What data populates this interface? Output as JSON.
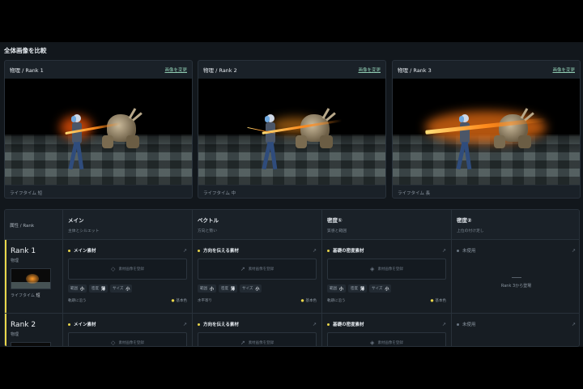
{
  "section_title": "全体画像を比較",
  "cards": [
    {
      "title": "物理 / Rank 1",
      "change": "画像を変更",
      "lifetime": "ライフタイム 短"
    },
    {
      "title": "物理 / Rank 2",
      "change": "画像を変更",
      "lifetime": "ライフタイム 中"
    },
    {
      "title": "物理 / Rank 3",
      "change": "画像を変更",
      "lifetime": "ライフタイム 長"
    }
  ],
  "table": {
    "attr_header": "属性 / Rank",
    "columns": [
      {
        "title": "メイン",
        "sub": "主体とシルエット"
      },
      {
        "title": "ベクトル",
        "sub": "方向と勢い"
      },
      {
        "title": "密度①",
        "sub": "質感と範囲"
      },
      {
        "title": "密度②",
        "sub": "上位の付け足し"
      }
    ],
    "rows": [
      {
        "rank": "Rank 1",
        "category": "物理",
        "lifetime_label": "ライフタイム",
        "lifetime_value": "短",
        "cells": [
          {
            "label": "メイン素材",
            "drop": "素材画像を登録",
            "params": [
              {
                "k": "範囲",
                "v": "小"
              },
              {
                "k": "密度",
                "v": "薄"
              },
              {
                "k": "サイズ",
                "v": "小"
              }
            ],
            "note": "軌跡に沿う",
            "status": "基本色"
          },
          {
            "label": "方向を伝える素材",
            "drop": "素材画像を登録",
            "params": [
              {
                "k": "範囲",
                "v": "小"
              },
              {
                "k": "密度",
                "v": "薄"
              },
              {
                "k": "サイズ",
                "v": "小"
              }
            ],
            "note": "水平寄り",
            "status": "基本色"
          },
          {
            "label": "基礎の密度素材",
            "drop": "素材画像を登録",
            "params": [
              {
                "k": "範囲",
                "v": "小"
              },
              {
                "k": "密度",
                "v": "薄"
              },
              {
                "k": "サイズ",
                "v": "小"
              }
            ],
            "note": "軌跡に沿う",
            "status": "基本色"
          },
          {
            "label": "未使用",
            "unused_text": "Rank 3から登場"
          }
        ]
      },
      {
        "rank": "Rank 2",
        "category": "物理",
        "cells": [
          {
            "label": "メイン素材",
            "drop": "素材画像を登録"
          },
          {
            "label": "方向を伝える素材",
            "drop": "素材画像を登録"
          },
          {
            "label": "基礎の密度素材",
            "drop": "素材画像を登録"
          },
          {
            "label": "未使用"
          }
        ]
      }
    ]
  },
  "colors": {
    "accent": "#e9d64a",
    "link": "#8ec9b0",
    "bg": "#12171c"
  }
}
